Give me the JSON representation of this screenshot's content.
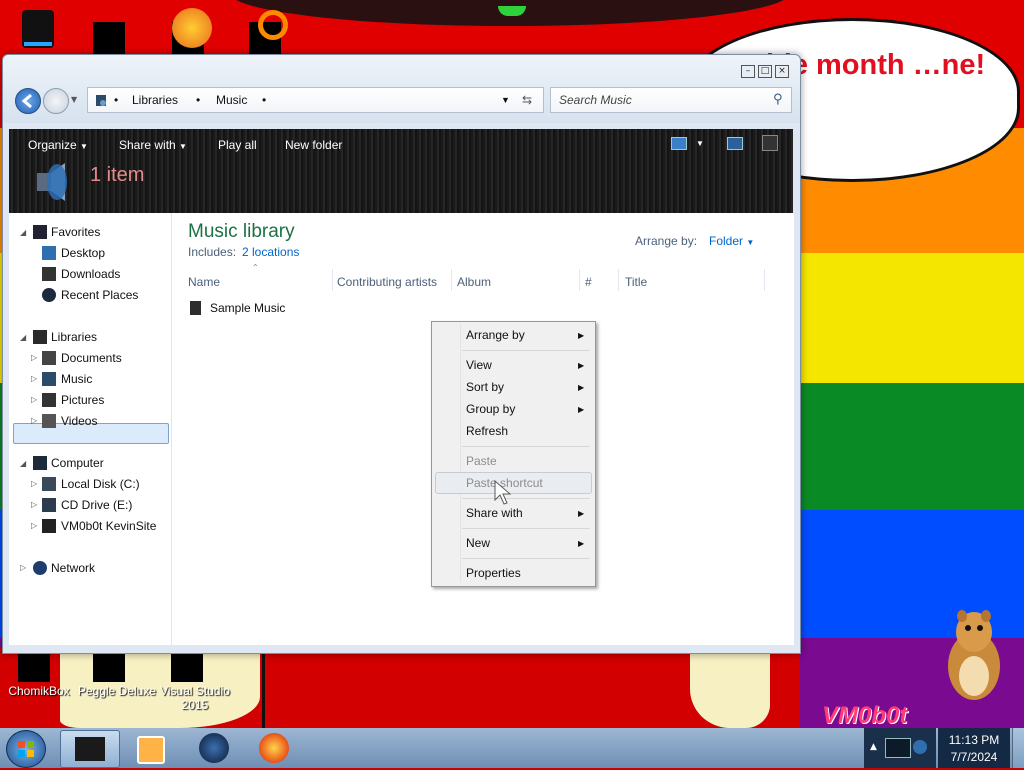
{
  "wallpaper": {
    "speech_bubble_text": "… pride month …ne!",
    "watermark": "VM0b0t",
    "colors": [
      "#e40303",
      "#ff8c00",
      "#ffed00",
      "#008026",
      "#004dff",
      "#750787"
    ]
  },
  "desktop_icons": [
    {
      "label": "ChomikBox"
    },
    {
      "label": "Peggle Deluxe"
    },
    {
      "label": "Visual Studio 2015"
    }
  ],
  "window": {
    "caption_buttons": {
      "minimize": "–",
      "maximize": "□",
      "close": "×"
    },
    "breadcrumb": [
      "Libraries",
      "Music"
    ],
    "search_placeholder": "Search Music",
    "toolbar": {
      "organize": "Organize",
      "share_with": "Share with",
      "play_all": "Play all",
      "new_folder": "New folder"
    },
    "item_count": "1 item",
    "nav": {
      "favorites": {
        "label": "Favorites",
        "items": [
          "Desktop",
          "Downloads",
          "Recent Places"
        ]
      },
      "libraries": {
        "label": "Libraries",
        "items": [
          "Documents",
          "Music",
          "Pictures",
          "Videos"
        ]
      },
      "computer": {
        "label": "Computer",
        "items": [
          "Local Disk (C:)",
          "CD Drive (E:)",
          "VM0b0t KevinSite"
        ]
      },
      "network": {
        "label": "Network"
      }
    },
    "library": {
      "title": "Music library",
      "includes_label": "Includes:",
      "includes_link": "2 locations",
      "arrange_label": "Arrange by:",
      "arrange_value": "Folder"
    },
    "columns": [
      "Name",
      "Contributing artists",
      "Album",
      "#",
      "Title"
    ],
    "files": [
      {
        "name": "Sample Music"
      }
    ]
  },
  "context_menu": {
    "items": [
      {
        "label": "Arrange by",
        "submenu": true,
        "disabled": false
      },
      {
        "label": "View",
        "submenu": true,
        "disabled": false
      },
      {
        "label": "Sort by",
        "submenu": true,
        "disabled": false
      },
      {
        "label": "Group by",
        "submenu": true,
        "disabled": false
      },
      {
        "label": "Refresh",
        "submenu": false,
        "disabled": false
      },
      {
        "label": "Paste",
        "submenu": false,
        "disabled": true
      },
      {
        "label": "Paste shortcut",
        "submenu": false,
        "disabled": true
      },
      {
        "label": "Share with",
        "submenu": true,
        "disabled": false
      },
      {
        "label": "New",
        "submenu": true,
        "disabled": false
      },
      {
        "label": "Properties",
        "submenu": false,
        "disabled": false
      }
    ]
  },
  "taskbar": {
    "time": "11:13 PM",
    "date": "7/7/2024"
  },
  "colors": {
    "library_title": "#1e7145",
    "link": "#0066cc",
    "item_count": "#e68a8a",
    "selection": "#dcebfc"
  }
}
